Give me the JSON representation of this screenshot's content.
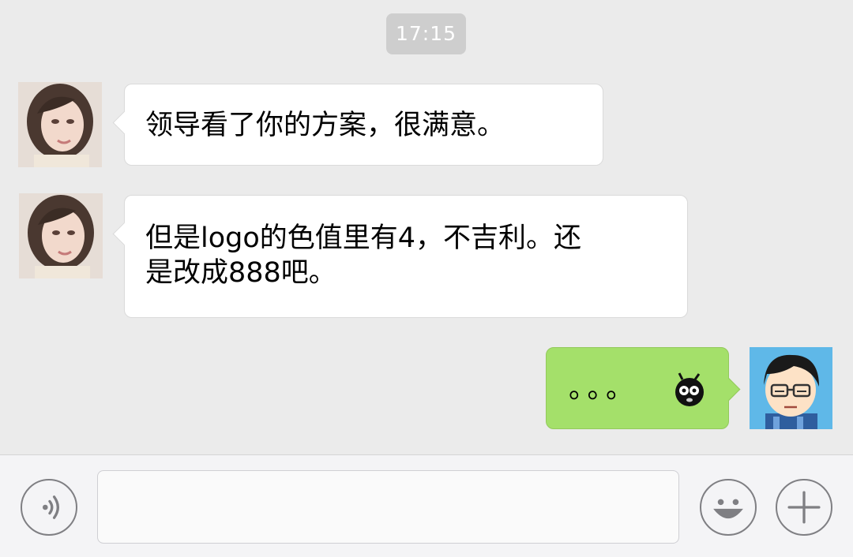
{
  "chat": {
    "timestamp": "17:15",
    "messages": [
      {
        "direction": "incoming",
        "sender_avatar": "female-avatar-photo",
        "text": "领导看了你的方案，很满意。"
      },
      {
        "direction": "incoming",
        "sender_avatar": "female-avatar-photo",
        "text_line1": "但是logo的色值里有4，不吉利。还",
        "text_line2": "是改成888吧。"
      },
      {
        "direction": "outgoing",
        "sender_avatar": "cartoon-man-avatar",
        "text": "。。。",
        "emoji": "dizzy-black-bug-emoji"
      }
    ]
  },
  "input_bar": {
    "voice_button_icon": "voice-icon",
    "input_value": "",
    "emoji_button_icon": "smiley-icon",
    "plus_button_icon": "plus-icon"
  },
  "colors": {
    "chat_background": "#ebebeb",
    "incoming_bubble": "#ffffff",
    "outgoing_bubble": "#a4e06a",
    "timestamp_pill": "#cecece",
    "input_bar_background": "#f4f4f6"
  }
}
